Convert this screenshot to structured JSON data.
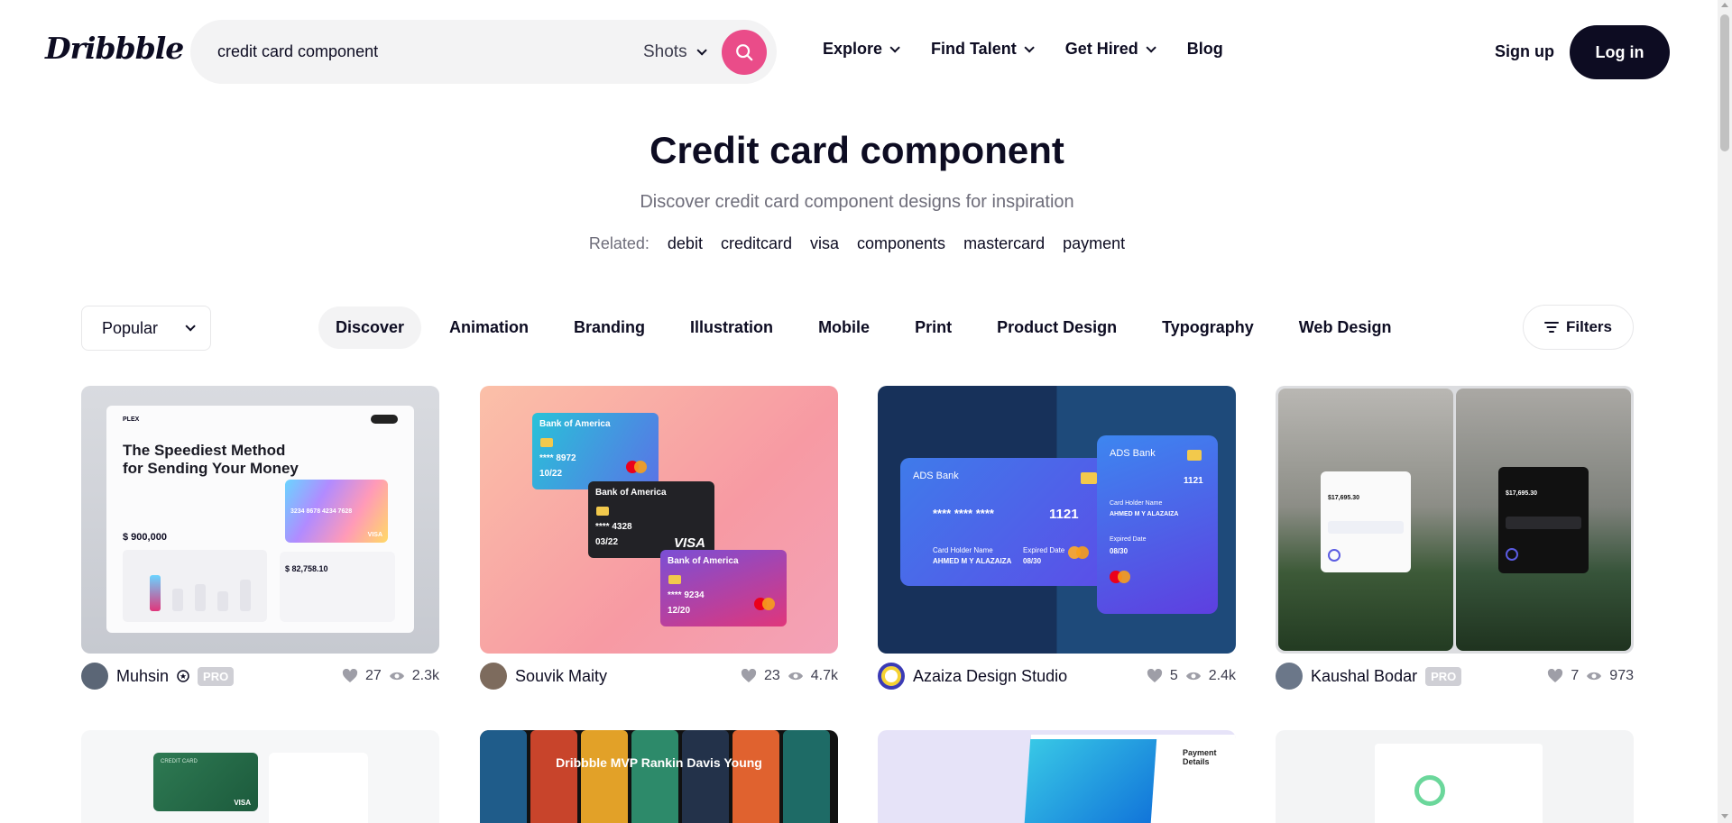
{
  "header": {
    "logo": "Dribbble",
    "search": {
      "value": "credit card component",
      "scope": "Shots"
    },
    "nav": [
      "Explore",
      "Find Talent",
      "Get Hired",
      "Blog"
    ],
    "signup": "Sign up",
    "login": "Log in"
  },
  "hero": {
    "title": "Credit card component",
    "subtitle": "Discover credit card component designs for inspiration",
    "related_label": "Related:",
    "related": [
      "debit",
      "creditcard",
      "visa",
      "components",
      "mastercard",
      "payment"
    ]
  },
  "filterbar": {
    "sort": "Popular",
    "categories": [
      "Discover",
      "Animation",
      "Branding",
      "Illustration",
      "Mobile",
      "Print",
      "Product Design",
      "Typography",
      "Web Design"
    ],
    "active_category": "Discover",
    "filters_label": "Filters"
  },
  "shots": [
    {
      "author": "Muhsin",
      "pro": "PRO",
      "likes": "27",
      "views": "2.3k",
      "preview": {
        "brand": "PLEX",
        "headline": "The Speediest Method for Sending Your Money",
        "amount": "$ 900,000",
        "balance": "$ 82,758.10",
        "card_number": "3234 8678 4234 7628",
        "card_brand": "VISA"
      }
    },
    {
      "author": "Souvik Maity",
      "pro": "",
      "likes": "23",
      "views": "4.7k",
      "preview": {
        "bank": "Bank of America",
        "card1": "**** 8972",
        "card1_exp": "10/22",
        "card2": "**** 4328",
        "card2_exp": "03/22",
        "card3": "**** 9234",
        "card3_exp": "12/20",
        "visa": "VISA"
      }
    },
    {
      "author": "Azaiza Design Studio",
      "pro": "",
      "likes": "5",
      "views": "2.4k",
      "preview": {
        "bank": "ADS Bank",
        "number_end": "1121",
        "masked": "**** **** ****",
        "holder_label": "Card Holder Name",
        "holder": "AHMED M Y ALAZAIZA",
        "exp_label": "Expired Date",
        "exp": "08/30"
      }
    },
    {
      "author": "Kaushal Bodar",
      "pro": "PRO",
      "likes": "7",
      "views": "973",
      "preview": {
        "amount": "$17,695.30"
      }
    }
  ],
  "row2": {
    "shot2_text": "Dribbble MVP Rankin Davis Young",
    "shot3_title": "Payment Details",
    "shot1_card": "CREDIT CARD",
    "shot1_visa": "VISA"
  }
}
